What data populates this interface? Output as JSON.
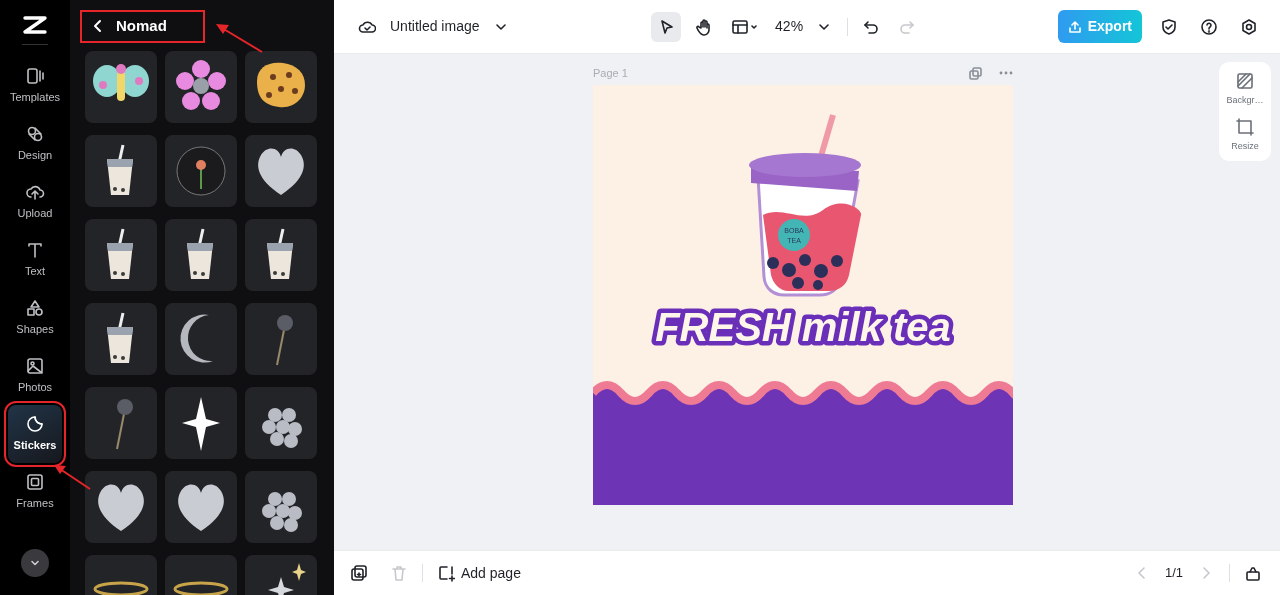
{
  "sidebar": {
    "items": [
      {
        "label": "Templates",
        "kind": "templates",
        "selected": false,
        "highlighted": false
      },
      {
        "label": "Design",
        "kind": "design",
        "selected": false,
        "highlighted": false
      },
      {
        "label": "Upload",
        "kind": "upload",
        "selected": false,
        "highlighted": false
      },
      {
        "label": "Text",
        "kind": "text",
        "selected": false,
        "highlighted": false
      },
      {
        "label": "Shapes",
        "kind": "shapes",
        "selected": false,
        "highlighted": false
      },
      {
        "label": "Photos",
        "kind": "photos",
        "selected": false,
        "highlighted": false
      },
      {
        "label": "Stickers",
        "kind": "stickers",
        "selected": true,
        "highlighted": true
      },
      {
        "label": "Frames",
        "kind": "frames",
        "selected": false,
        "highlighted": false
      }
    ]
  },
  "panel": {
    "title": "Nomad",
    "highlighted": true,
    "stickers": [
      {
        "kind": "butterfly"
      },
      {
        "kind": "flower"
      },
      {
        "kind": "cookie"
      },
      {
        "kind": "cup"
      },
      {
        "kind": "globe"
      },
      {
        "kind": "heart"
      },
      {
        "kind": "cup"
      },
      {
        "kind": "cup"
      },
      {
        "kind": "cup"
      },
      {
        "kind": "cup"
      },
      {
        "kind": "moon"
      },
      {
        "kind": "bud"
      },
      {
        "kind": "bud"
      },
      {
        "kind": "star"
      },
      {
        "kind": "berries"
      },
      {
        "kind": "heart"
      },
      {
        "kind": "heart"
      },
      {
        "kind": "berries"
      },
      {
        "kind": "ring"
      },
      {
        "kind": "ring"
      },
      {
        "kind": "sparkle"
      }
    ]
  },
  "toolbar": {
    "title": "Untitled image",
    "zoom": "42%",
    "export_label": "Export",
    "tools": [
      {
        "kind": "select",
        "selected": true
      },
      {
        "kind": "hand",
        "selected": false
      }
    ],
    "redo_disabled": true
  },
  "page": {
    "label": "Page 1",
    "headline": "FRESH milk tea",
    "cup_label": [
      "BOBA",
      "TEA"
    ]
  },
  "side_tools": [
    {
      "label": "Backgr…",
      "kind": "background"
    },
    {
      "label": "Resize",
      "kind": "resize"
    }
  ],
  "bottom_bar": {
    "add_page": "Add page",
    "pager": "1/1",
    "delete_disabled": true,
    "prev_disabled": true
  }
}
